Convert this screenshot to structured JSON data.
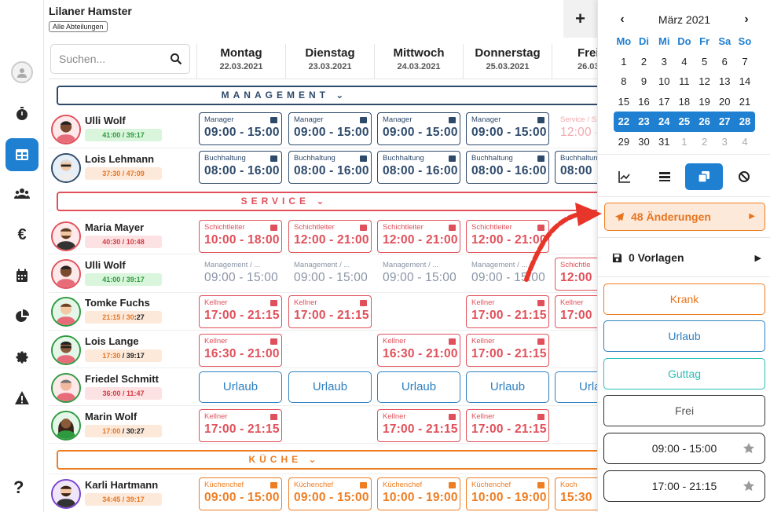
{
  "header": {
    "company": "Lilaner Hamster",
    "department_filter": "Alle Abteilungen",
    "add_label": "+"
  },
  "search": {
    "placeholder": "Suchen..."
  },
  "days": [
    {
      "name": "Montag",
      "date": "22.03.2021"
    },
    {
      "name": "Dienstag",
      "date": "23.03.2021"
    },
    {
      "name": "Mittwoch",
      "date": "24.03.2021"
    },
    {
      "name": "Donnerstag",
      "date": "25.03.2021"
    },
    {
      "name": "Frei",
      "date": "26.03"
    }
  ],
  "groups": {
    "management": "MANAGEMENT",
    "service": "SERVICE",
    "kueche": "KÜCHE",
    "chevron": "⌄"
  },
  "employees": [
    {
      "name": "Ulli Wolf",
      "hours": "41:00 / 39:17",
      "hours_a": "41:00 / 39:17",
      "hours_b": ""
    },
    {
      "name": "Lois Lehmann",
      "hours_a": "37:30 / 47:09",
      "hours_b": ""
    },
    {
      "name": "Maria Mayer",
      "hours_a": "40:30 / 10:48",
      "hours_b": ""
    },
    {
      "name": "Ulli Wolf",
      "hours_a": "41:00 / 39:17",
      "hours_b": ""
    },
    {
      "name": "Tomke Fuchs",
      "hours_a": "21:15 / 30",
      "hours_b": ":27"
    },
    {
      "name": "Lois Lange",
      "hours_a": "17:30",
      "hours_b": " / 39:17"
    },
    {
      "name": "Friedel Schmitt",
      "hours_a": "36:00 / 11:47",
      "hours_b": ""
    },
    {
      "name": "Marin Wolf",
      "hours_a": "17:00",
      "hours_b": " / 30:27"
    },
    {
      "name": "Karli Hartmann",
      "hours_a": "34:45 / 39:17",
      "hours_b": ""
    }
  ],
  "shifts": {
    "r0": [
      {
        "label": "Manager",
        "time": "09:00 - 15:00"
      },
      {
        "label": "Manager",
        "time": "09:00 - 15:00"
      },
      {
        "label": "Manager",
        "time": "09:00 - 15:00"
      },
      {
        "label": "Manager",
        "time": "09:00 - 15:00"
      },
      {
        "label": "Service / S",
        "time": "12:00 -"
      }
    ],
    "r1": [
      {
        "label": "Buchhaltung",
        "time": "08:00 - 16:00"
      },
      {
        "label": "Buchhaltung",
        "time": "08:00 - 16:00"
      },
      {
        "label": "Buchhaltung",
        "time": "08:00 - 16:00"
      },
      {
        "label": "Buchhaltung",
        "time": "08:00 - 16:00"
      },
      {
        "label": "Buchhaltung",
        "time": "08:00"
      }
    ],
    "r2": [
      {
        "label": "Schichtleiter",
        "time": "10:00 - 18:00"
      },
      {
        "label": "Schichtleiter",
        "time": "12:00 - 21:00"
      },
      {
        "label": "Schichtleiter",
        "time": "12:00 - 21:00"
      },
      {
        "label": "Schichtleiter",
        "time": "12:00 - 21:00"
      }
    ],
    "r3": [
      {
        "label": "Management / ...",
        "time": "09:00 - 15:00"
      },
      {
        "label": "Management / ...",
        "time": "09:00 - 15:00"
      },
      {
        "label": "Management / ...",
        "time": "09:00 - 15:00"
      },
      {
        "label": "Management / ...",
        "time": "09:00 - 15:00"
      },
      {
        "label": "Schichtle",
        "time": "12:00"
      }
    ],
    "r4": [
      {
        "label": "Kellner",
        "time": "17:00 - 21:15"
      },
      {
        "label": "Kellner",
        "time": "17:00 - 21:15"
      },
      {
        "label": "Kellner",
        "time": "17:00 - 21:15"
      },
      {
        "label": "Kellner",
        "time": "17:00 - 21:15"
      },
      {
        "label": "Kellner",
        "time": "17:00"
      }
    ],
    "r5": [
      {
        "label": "Kellner",
        "time": "16:30 - 21:00"
      },
      {
        "label": "Kellner",
        "time": "16:30 - 21:00"
      },
      {
        "label": "Kellner",
        "time": "17:00 - 21:15"
      }
    ],
    "r6": [
      "Urlaub",
      "Urlaub",
      "Urlaub",
      "Urlaub",
      "Urla"
    ],
    "r7": [
      {
        "label": "Kellner",
        "time": "17:00 - 21:15"
      },
      {
        "label": "Kellner",
        "time": "17:00 - 21:15"
      },
      {
        "label": "Kellner",
        "time": "17:00 - 21:15"
      }
    ],
    "r8": [
      {
        "label": "Küchenchef",
        "time": "09:00 - 15:00"
      },
      {
        "label": "Küchenchef",
        "time": "09:00 - 15:00"
      },
      {
        "label": "Küchenchef",
        "time": "10:00 - 19:00"
      },
      {
        "label": "Küchenchef",
        "time": "10:00 - 19:00"
      },
      {
        "label": "Koch",
        "time": "15:30"
      }
    ]
  },
  "calendar": {
    "month": "März 2021",
    "prev": "‹",
    "next": "›",
    "weekdays": [
      "Mo",
      "Di",
      "Mi",
      "Do",
      "Fr",
      "Sa",
      "So"
    ],
    "weeks": [
      [
        "1",
        "2",
        "3",
        "4",
        "5",
        "6",
        "7"
      ],
      [
        "8",
        "9",
        "10",
        "11",
        "12",
        "13",
        "14"
      ],
      [
        "15",
        "16",
        "17",
        "18",
        "19",
        "20",
        "21"
      ],
      [
        "22",
        "23",
        "24",
        "25",
        "26",
        "27",
        "28"
      ],
      [
        "29",
        "30",
        "31",
        "1",
        "2",
        "3",
        "4"
      ]
    ],
    "selected_week": 3
  },
  "panel": {
    "changes": "48 Änderungen",
    "templates": "0 Vorlagen",
    "krank": "Krank",
    "urlaub": "Urlaub",
    "guttag": "Guttag",
    "frei": "Frei",
    "template1": "09:00 - 15:00",
    "template2": "17:00 - 21:15"
  },
  "help": "?",
  "colors": {
    "primary": "#1f7fd1",
    "management": "#2e4a6b",
    "service": "#e0505a",
    "kueche": "#ef7d22",
    "annotation_arrow": "#e8352a"
  }
}
